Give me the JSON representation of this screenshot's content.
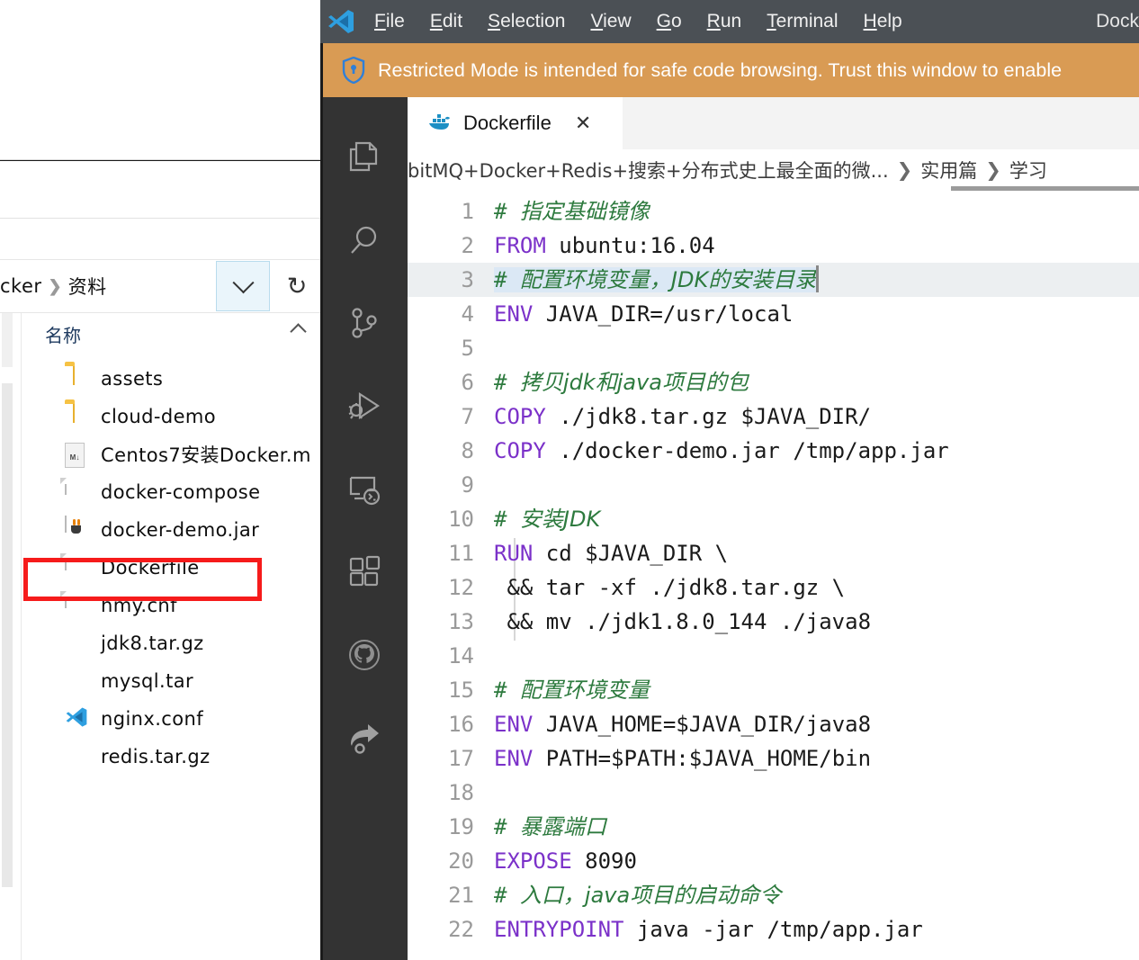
{
  "explorer": {
    "address": {
      "breadcrumb": [
        "cker",
        "资料"
      ],
      "separator": "❯",
      "dropdown_icon": "chevron-down-icon",
      "refresh_icon": "refresh-icon",
      "refresh_glyph": "↻"
    },
    "column_header": "名称",
    "files": [
      {
        "name": "assets",
        "icon": "folder-icon"
      },
      {
        "name": "cloud-demo",
        "icon": "folder-icon"
      },
      {
        "name": "Centos7安装Docker.m",
        "icon": "markdown-file-icon",
        "badge": "M↓"
      },
      {
        "name": "docker-compose",
        "icon": "generic-file-icon"
      },
      {
        "name": "docker-demo.jar",
        "icon": "java-jar-icon"
      },
      {
        "name": "Dockerfile",
        "icon": "generic-file-icon",
        "highlighted": true
      },
      {
        "name": "hmy.cnf",
        "icon": "generic-file-icon"
      },
      {
        "name": "jdk8.tar.gz",
        "icon": "archive-icon"
      },
      {
        "name": "mysql.tar",
        "icon": "archive-icon"
      },
      {
        "name": "nginx.conf",
        "icon": "vscode-file-icon"
      },
      {
        "name": "redis.tar.gz",
        "icon": "archive-icon"
      }
    ],
    "highlight_color": "#f61b1b"
  },
  "vscode": {
    "menubar": {
      "logo": "vscode-logo-icon",
      "items": [
        {
          "accel": "F",
          "rest": "ile"
        },
        {
          "accel": "E",
          "rest": "dit"
        },
        {
          "accel": "S",
          "rest": "election"
        },
        {
          "accel": "V",
          "rest": "iew"
        },
        {
          "accel": "G",
          "rest": "o"
        },
        {
          "accel": "R",
          "rest": "un"
        },
        {
          "accel": "T",
          "rest": "erminal"
        },
        {
          "accel": "H",
          "rest": "elp"
        }
      ],
      "window_title": "Dock",
      "background": "#4b5055"
    },
    "banner": {
      "icon": "shield-icon",
      "text": "Restricted Mode is intended for safe code browsing. Trust this window to enable",
      "background": "#d99b54"
    },
    "activitybar": {
      "icons": [
        "explorer-icon",
        "search-icon",
        "source-control-icon",
        "run-and-debug-icon",
        "remote-explorer-icon",
        "extensions-icon",
        "github-icon",
        "share-icon"
      ],
      "background": "#333333"
    },
    "tab": {
      "icon": "docker-icon",
      "label": "Dockerfile",
      "close_glyph": "✕"
    },
    "breadcrumb": {
      "segments": [
        "bitMQ+Docker+Redis+搜索+分布式史上最全面的微...",
        "实用篇",
        "学习"
      ],
      "separator": "❯"
    },
    "code": {
      "lines": [
        {
          "n": "1",
          "comment": "# 指定基础镜像"
        },
        {
          "n": "2",
          "kw": "FROM",
          "rest": " ubuntu:16.04"
        },
        {
          "n": "3",
          "comment": "# 配置环境变量，JDK的安装目录",
          "selected": true,
          "cursor": true
        },
        {
          "n": "4",
          "kw": "ENV",
          "rest": " JAVA_DIR=/usr/local"
        },
        {
          "n": "5",
          "rest": ""
        },
        {
          "n": "6",
          "comment": "# 拷贝jdk和java项目的包"
        },
        {
          "n": "7",
          "kw": "COPY",
          "rest": " ./jdk8.tar.gz $JAVA_DIR/"
        },
        {
          "n": "8",
          "kw": "COPY",
          "rest": " ./docker-demo.jar /tmp/app.jar"
        },
        {
          "n": "9",
          "rest": ""
        },
        {
          "n": "10",
          "comment": "# 安装JDK"
        },
        {
          "n": "11",
          "kw": "RUN",
          "rest": " cd $JAVA_DIR \\"
        },
        {
          "n": "12",
          "rest": " && tar -xf ./jdk8.tar.gz \\"
        },
        {
          "n": "13",
          "rest": " && mv ./jdk1.8.0_144 ./java8"
        },
        {
          "n": "14",
          "rest": ""
        },
        {
          "n": "15",
          "comment": "# 配置环境变量"
        },
        {
          "n": "16",
          "kw": "ENV",
          "rest": " JAVA_HOME=$JAVA_DIR/java8"
        },
        {
          "n": "17",
          "kw": "ENV",
          "rest": " PATH=$PATH:$JAVA_HOME/bin"
        },
        {
          "n": "18",
          "rest": ""
        },
        {
          "n": "19",
          "comment": "# 暴露端口"
        },
        {
          "n": "20",
          "kw": "EXPOSE",
          "rest": " 8090"
        },
        {
          "n": "21",
          "comment": "# 入口，java项目的启动命令"
        },
        {
          "n": "22",
          "kw": "ENTRYPOINT",
          "rest": " java -jar /tmp/app.jar"
        }
      ],
      "keyword_color": "#7b31c9",
      "comment_color": "#2d7a3e",
      "linenumber_color": "#9a9a9a",
      "selection_color": "#dbe8f5"
    }
  }
}
